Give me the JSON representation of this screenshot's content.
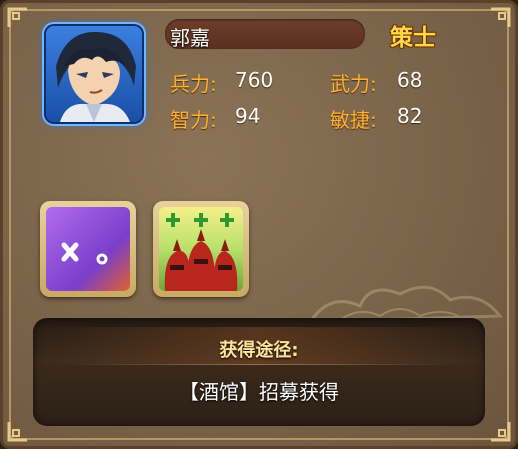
{
  "general": {
    "name": "郭嘉",
    "class": "策士"
  },
  "stats": [
    {
      "label": "兵力:",
      "value": "760"
    },
    {
      "label": "武力:",
      "value": "68"
    },
    {
      "label": "智力:",
      "value": "94"
    },
    {
      "label": "敏捷:",
      "value": "82"
    }
  ],
  "skills": [
    {
      "icon": "purple-mark-skill-icon"
    },
    {
      "icon": "red-soldiers-heal-skill-icon"
    }
  ],
  "source": {
    "title": "获得途径:",
    "text": "【酒馆】招募获得"
  }
}
